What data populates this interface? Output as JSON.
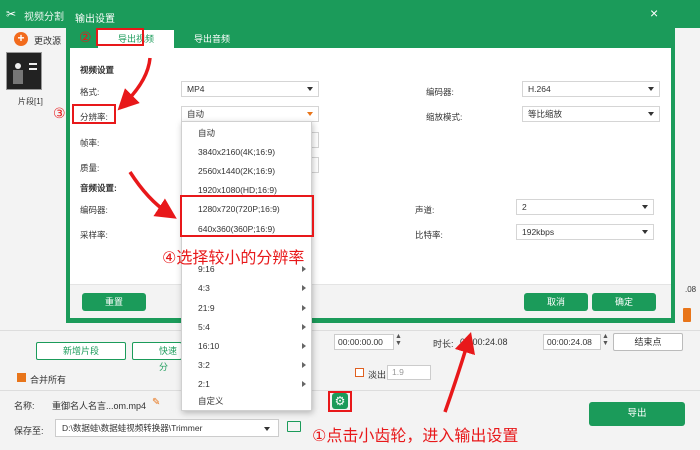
{
  "app": {
    "title": "视频分割",
    "change_source": "更改源",
    "clip_label": "片段[1]"
  },
  "dialog": {
    "title": "输出设置",
    "close_icon": "×",
    "tabs": [
      {
        "label": "导出视频"
      },
      {
        "label": "导出音频"
      }
    ],
    "video_section": "视频设置",
    "format_label": "格式:",
    "format_value": "MP4",
    "encoder_label": "编码器:",
    "encoder_value": "H.264",
    "resolution_label": "分辨率:",
    "resolution_value": "自动",
    "scale_label": "缩放模式:",
    "scale_value": "等比缩放",
    "framerate_label": "帧率:",
    "quality_label": "质量:",
    "audio_section": "音频设置:",
    "audio_encoder_label": "编码器:",
    "channel_label": "声道:",
    "channel_value": "2",
    "samplerate_label": "采样率:",
    "bitrate_label": "比特率:",
    "bitrate_value": "192kbps",
    "reset_button": "重置",
    "cancel_button": "取消",
    "ok_button": "确定"
  },
  "dropdown": {
    "options": [
      {
        "label": "自动",
        "submenu": false
      },
      {
        "label": "3840x2160(4K;16:9)",
        "submenu": false
      },
      {
        "label": "2560x1440(2K;16:9)",
        "submenu": false
      },
      {
        "label": "1920x1080(HD;16:9)",
        "submenu": false
      },
      {
        "label": "1280x720(720P;16:9)",
        "submenu": false
      },
      {
        "label": "640x360(360P;16:9)",
        "submenu": false
      },
      {
        "label": "9:16",
        "submenu": true
      },
      {
        "label": "4:3",
        "submenu": true
      },
      {
        "label": "21:9",
        "submenu": true
      },
      {
        "label": "5:4",
        "submenu": true
      },
      {
        "label": "16:10",
        "submenu": true
      },
      {
        "label": "3:2",
        "submenu": true
      },
      {
        "label": "2:1",
        "submenu": true
      },
      {
        "label": "自定义",
        "submenu": false
      }
    ]
  },
  "bottom": {
    "add_clip_button": "新增片段",
    "quick_split_button": "快速分",
    "merge_all_label": "合并所有",
    "start_time": "00:00:00.00",
    "duration_label": "时长:",
    "duration_value": "00:00:24.08",
    "end_time": "00:00:24.08",
    "end_point_button": "结束点",
    "fade_out_label": "淡出",
    "fade_out_value": "1.9",
    "name_label": "名称:",
    "name_value": "重御名人名言...om.mp4",
    "save_to_label": "保存至:",
    "save_path": "D:\\数据蛙\\数据蛙视频转换器\\Trimmer",
    "export_button": "导出",
    "right_edge_text": ".08"
  },
  "annotations": {
    "step1": "①点击小齿轮，进入输出设置",
    "step2": "②",
    "step3": "③",
    "step4": "④选择较小的分辨率"
  },
  "colors": {
    "brand_green": "#1b9b5a",
    "accent_orange": "#e8751a",
    "annotation_red": "#e8181a"
  }
}
